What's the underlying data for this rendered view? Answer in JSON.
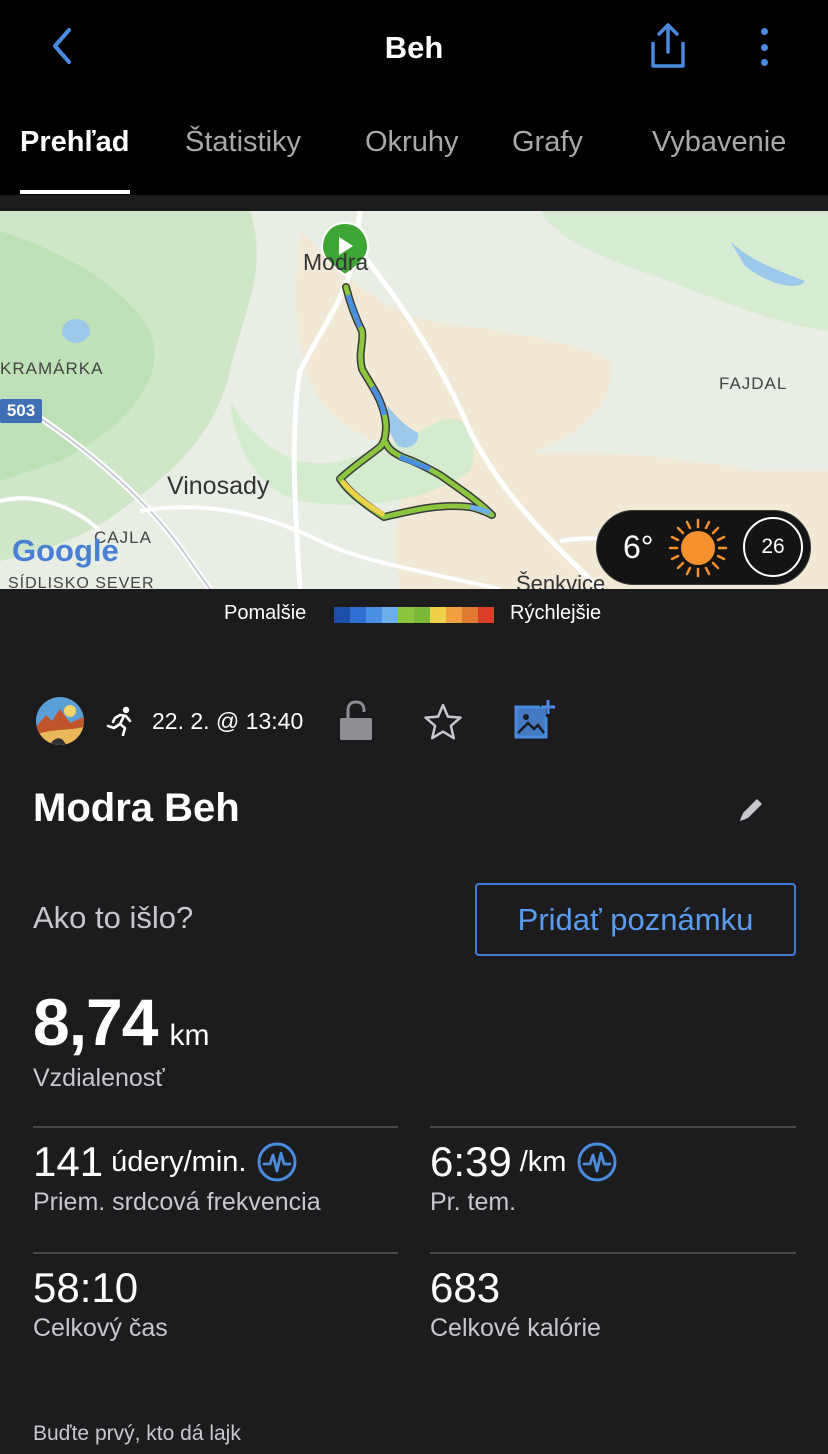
{
  "header": {
    "title": "Beh",
    "icons": {
      "back": "chevron-left-icon",
      "share": "share-icon",
      "more": "more-vertical-icon"
    },
    "accent": "#4a8be0"
  },
  "tabs": [
    {
      "label": "Prehľad",
      "active": true
    },
    {
      "label": "Štatistiky",
      "active": false
    },
    {
      "label": "Okruhy",
      "active": false
    },
    {
      "label": "Grafy",
      "active": false
    },
    {
      "label": "Vybavenie",
      "active": false
    }
  ],
  "map": {
    "labels": {
      "modra": "Modra",
      "kramarka": "KRAMÁRKA",
      "fajdal": "FAJDAL",
      "road503": "503",
      "vinosady": "Vinosady",
      "cajla": "CAJLA",
      "sidlisko": "SÍDLISKO SEVER",
      "senkvice": "Šenkvice",
      "google": "Google"
    },
    "weather": {
      "temperature": "6°",
      "wind": "26",
      "icon": "sun-icon"
    }
  },
  "legend": {
    "slower": "Pomalšie",
    "faster": "Rýchlejšie",
    "colors": [
      "#1e4fa8",
      "#2f6fd1",
      "#4a90e2",
      "#6aaeea",
      "#8cc63f",
      "#7cb83a",
      "#f0d24a",
      "#f0a040",
      "#e07a30",
      "#d9402a"
    ]
  },
  "activity": {
    "date": "22. 2. @ 13:40",
    "title": "Modra Beh",
    "prompt": "Ako to išlo?",
    "add_note": "Pridať poznámku",
    "distance": {
      "value": "8,74",
      "unit": "km",
      "label": "Vzdialenosť"
    },
    "stats": [
      {
        "value": "141",
        "unit": "údery/min.",
        "label": "Priem. srdcová frekvencia",
        "icon": "heart-rate-icon"
      },
      {
        "value": "6:39",
        "unit": "/km",
        "label": "Pr. tem.",
        "icon": "heart-rate-icon"
      },
      {
        "value": "58:10",
        "unit": "",
        "label": "Celkový čas"
      },
      {
        "value": "683",
        "unit": "",
        "label": "Celkové kalórie"
      }
    ],
    "likes": "Buďte prvý, kto dá lajk"
  }
}
